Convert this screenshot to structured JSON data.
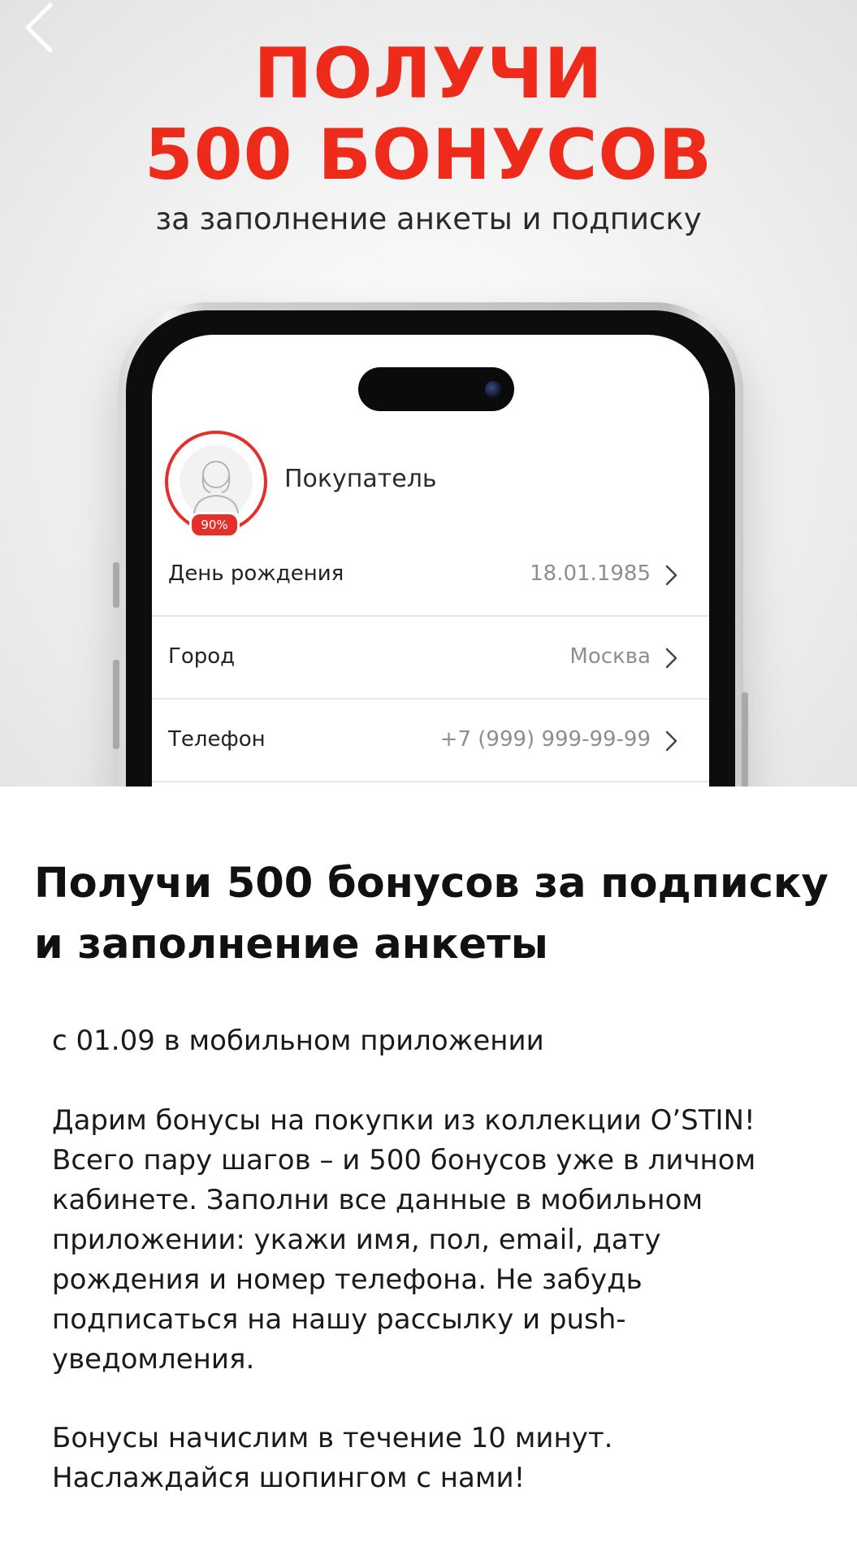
{
  "banner": {
    "headline_line1": "ПОЛУЧИ",
    "headline_line2": "500 БОНУСОВ",
    "subheadline": "за заполнение анкеты и подписку",
    "accent_color": "#ee2a1b"
  },
  "nav": {
    "back_icon": "chevron-left-icon"
  },
  "phone": {
    "profile": {
      "name": "Покупатель",
      "completion_badge": "90%"
    },
    "rows": [
      {
        "label": "День рождения",
        "value": "18.01.1985"
      },
      {
        "label": "Город",
        "value": "Москва"
      },
      {
        "label": "Телефон",
        "value": "+7 (999) 999-99-99"
      }
    ]
  },
  "article": {
    "title": "Получи 500 бонусов за подписку и заполнение анкеты",
    "date_line": "с 01.09 в мобильном приложении",
    "body": "Дарим бонусы на покупки из коллекции O’STIN! Всего пару шагов – и 500 бонусов уже в личном кабинете. Заполни все данные в мобильном приложении: укажи имя, пол, email, дату рождения и номер телефона. Не забудь подписаться на нашу рассылку и push-уведомления.",
    "footer": "Бонусы начислим в течение 10 минут. Наслаждайся шопингом с нами!"
  }
}
